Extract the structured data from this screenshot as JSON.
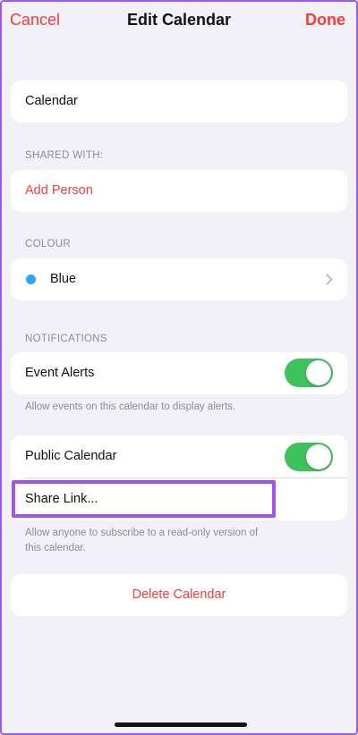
{
  "navbar": {
    "cancel_label": "Cancel",
    "title": "Edit Calendar",
    "done_label": "Done"
  },
  "calendar_name": {
    "value": "Calendar"
  },
  "shared_with": {
    "section_label": "SHARED WITH:",
    "add_person_label": "Add Person"
  },
  "colour": {
    "section_label": "COLOUR",
    "selected_value": "Blue",
    "dot_color": "#2aa8f5"
  },
  "notifications": {
    "section_label": "NOTIFICATIONS",
    "event_alerts_label": "Event Alerts",
    "event_alerts_on": true,
    "footnote": "Allow events on this calendar to display alerts."
  },
  "public": {
    "public_calendar_label": "Public Calendar",
    "public_calendar_on": true,
    "share_link_label": "Share Link...",
    "footnote_line1": "Allow anyone to subscribe to a read-only version of",
    "footnote_line2": "this calendar."
  },
  "delete": {
    "label": "Delete Calendar"
  },
  "colors": {
    "accent": "#f23d3d",
    "toggle_on": "#3ec35c",
    "highlight": "#a352f5",
    "background": "#f2f1f7"
  }
}
